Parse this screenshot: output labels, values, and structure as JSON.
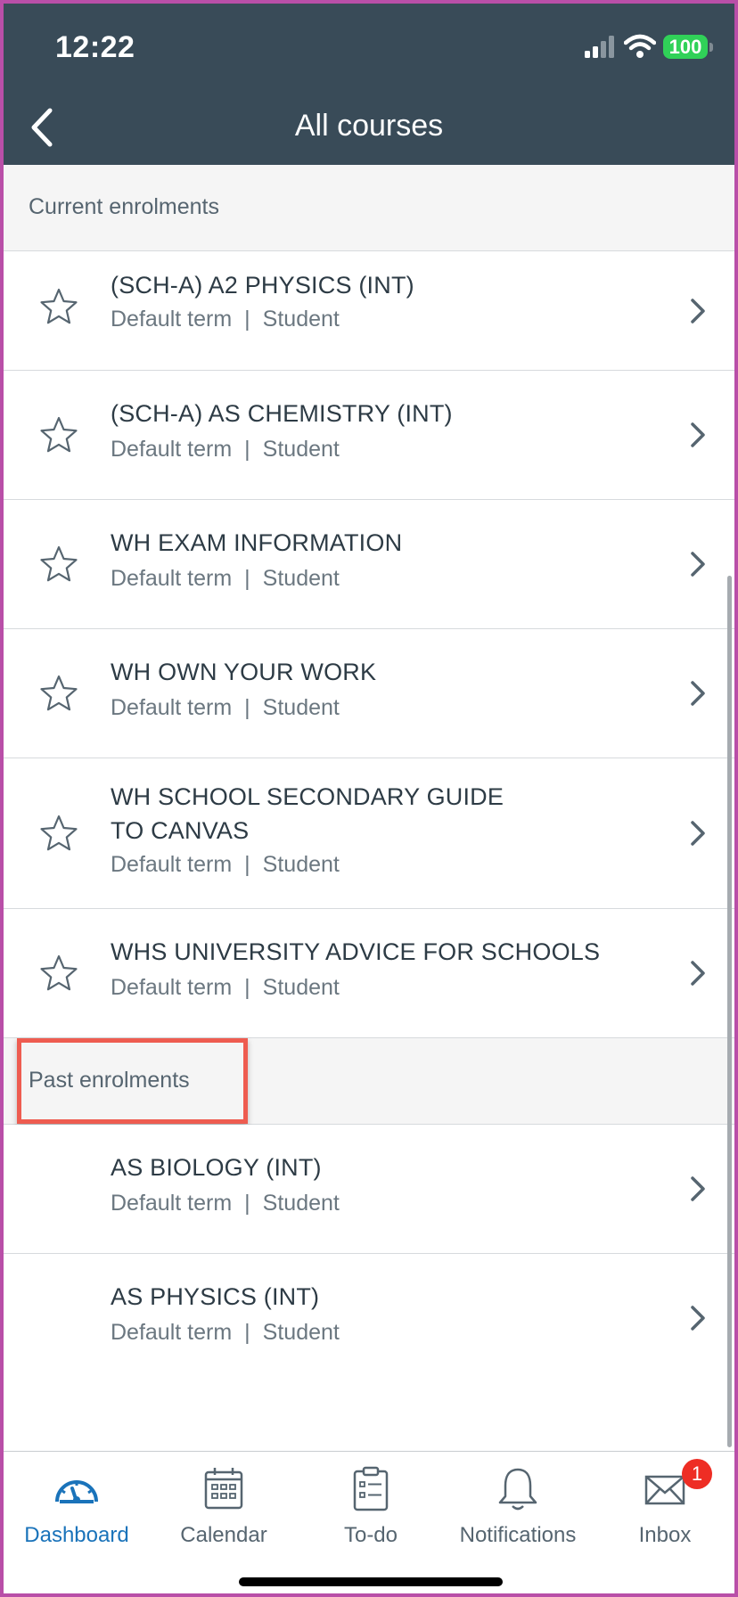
{
  "status_bar": {
    "time": "12:22",
    "battery": "100"
  },
  "header": {
    "title": "All courses"
  },
  "current_section": {
    "label": "Current enrolments"
  },
  "past_section": {
    "label": "Past enrolments"
  },
  "current_courses": [
    {
      "name": "(SCH-A) A2 PHYSICS (INT)",
      "term": "Default term",
      "role": "Student"
    },
    {
      "name": "(SCH-A) AS CHEMISTRY (INT)",
      "term": "Default term",
      "role": "Student"
    },
    {
      "name": "WH EXAM INFORMATION",
      "term": "Default term",
      "role": "Student"
    },
    {
      "name": "WH OWN YOUR WORK",
      "term": "Default term",
      "role": "Student"
    },
    {
      "name_line1": "WH SCHOOL SECONDARY GUIDE",
      "name_line2": "TO CANVAS",
      "term": "Default term",
      "role": "Student"
    },
    {
      "name": "WHS UNIVERSITY ADVICE FOR SCHOOLS",
      "term": "Default term",
      "role": "Student"
    }
  ],
  "past_courses": [
    {
      "name": "AS BIOLOGY (INT)",
      "term": "Default term",
      "role": "Student"
    },
    {
      "name": "AS PHYSICS (INT)",
      "term": "Default term",
      "role": "Student"
    }
  ],
  "separator": "|",
  "tabs": [
    {
      "label": "Dashboard",
      "icon": "dashboard-icon",
      "active": true
    },
    {
      "label": "Calendar",
      "icon": "calendar-icon"
    },
    {
      "label": "To-do",
      "icon": "todo-icon"
    },
    {
      "label": "Notifications",
      "icon": "bell-icon"
    },
    {
      "label": "Inbox",
      "icon": "mail-icon",
      "badge": "1"
    }
  ],
  "colors": {
    "header_bg": "#394b58",
    "accent": "#1a73ba",
    "highlight": "#ee5c50",
    "badge": "#ee2d24"
  }
}
